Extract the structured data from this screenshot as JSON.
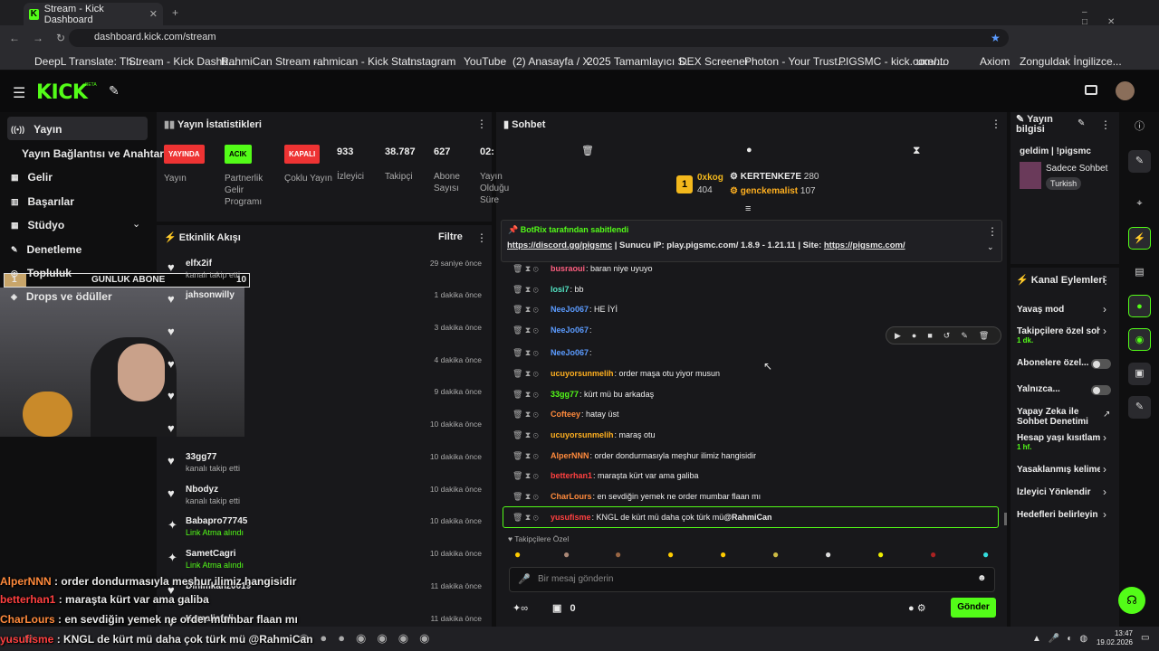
{
  "browser": {
    "tab_title": "Stream - Kick Dashboard",
    "url": "dashboard.kick.com/stream",
    "bookmarks": [
      "DeepL Translate: Th...",
      "Stream - Kick Dashb...",
      "RahmiCan Stream -...",
      "rahmican - Kick Stat...",
      "Instagram",
      "YouTube",
      "(2) Anasayfa / X",
      "2025 Tamamlayıcı S...",
      "DEX Screener",
      "Photon - Your Trust...",
      "PIGSMC - kick.com/...",
      "uxento",
      "Axiom",
      "Zonguldak İngilizce..."
    ]
  },
  "kick": {
    "logo": "KICK",
    "beta": "BETA"
  },
  "sidebar": {
    "items": [
      "Yayın",
      "Yayın Bağlantısı ve Anahtarı",
      "Gelir",
      "Başarılar",
      "Stüdyo",
      "Denetleme",
      "Topluluk",
      "Drops ve ödüller"
    ]
  },
  "overlay": {
    "goal_label": "GUNLUK ABONE",
    "goal_start": "1",
    "goal_target": "10"
  },
  "stats": {
    "title": "Yayın İstatistikleri",
    "items": [
      {
        "badge": "YAYINDA",
        "label": "Yayın"
      },
      {
        "badge": "ACIK",
        "label": "Partnerlik Gelir Programı"
      },
      {
        "badge": "KAPALI",
        "label": "Çoklu Yayın"
      },
      {
        "value": "933",
        "label": "İzleyici"
      },
      {
        "value": "38.787",
        "label": "Takipçi"
      },
      {
        "value": "627",
        "label": "Abone Sayısı"
      },
      {
        "value": "02:",
        "label": "Yayın Olduğu Süre"
      }
    ]
  },
  "activity": {
    "title": "Etkinlik Akışı",
    "filter": "Filtre",
    "items": [
      {
        "name": "elfx2if",
        "sub": "kanalı takip etti",
        "time": "29 saniye önce"
      },
      {
        "name": "jahsonwilly",
        "sub": "",
        "time": "1 dakika önce"
      },
      {
        "name": "",
        "sub": "",
        "time": "3 dakika önce"
      },
      {
        "name": "",
        "sub": "",
        "time": "4 dakika önce"
      },
      {
        "name": "",
        "sub": "",
        "time": "9 dakika önce"
      },
      {
        "name": "",
        "sub": "",
        "time": "10 dakika önce"
      },
      {
        "name": "33gg77",
        "sub": "kanalı takip etti",
        "time": "10 dakika önce"
      },
      {
        "name": "Nbodyz",
        "sub": "kanalı takip etti",
        "time": "10 dakika önce"
      },
      {
        "name": "Babapro77745",
        "sub": "Link Atma alındı",
        "time": "10 dakika önce"
      },
      {
        "name": "SametCagri",
        "sub": "Link Atma alındı",
        "time": "10 dakika önce"
      },
      {
        "name": "Dinimkanz0019",
        "sub": "",
        "time": "11 dakika önce"
      },
      {
        "name": "Kemaliafeli",
        "sub": "",
        "time": "11 dakika önce"
      }
    ]
  },
  "chat": {
    "title": "Sohbet",
    "leaders": [
      {
        "name": "0xkog",
        "count": "404"
      },
      {
        "name": "KERTENKE7E",
        "count": "280"
      },
      {
        "name": "genckemalist",
        "count": "107"
      }
    ],
    "pinned_by": "BotRix tarafından sabitlendi",
    "pinned_link1": "https://discord.gg/pigsmc",
    "pinned_mid": " | Sunucu IP: play.pigsmc.com/ 1.8.9 - 1.21.11 | Site: ",
    "pinned_link2": "https://pigsmc.com/",
    "messages": [
      {
        "user": "busraoui",
        "text": ": baran niye uyuyo",
        "color": "#ff5f80"
      },
      {
        "user": "losi7",
        "text": ": bb",
        "color": "#53e4c4"
      },
      {
        "user": "NeeJo067",
        "text": ": HE İYİ",
        "color": "#5b9bff"
      },
      {
        "user": "NeeJo067",
        "text": ":",
        "color": "#5b9bff"
      },
      {
        "user": "NeeJo067",
        "text": ":",
        "color": "#5b9bff"
      },
      {
        "user": "ucuyorsunmelih",
        "text": ": order maşa otu yiyor musun",
        "color": "#ffb020"
      },
      {
        "user": "33gg77",
        "text": ": kürt mü bu arkadaş",
        "color": "#53fc18"
      },
      {
        "user": "Cofteey",
        "text": ": hatay üst",
        "color": "#ff8a3c"
      },
      {
        "user": "ucuyorsunmelih",
        "text": ": maraş otu",
        "color": "#ffb020"
      },
      {
        "user": "AlperNNN",
        "text": ": order dondurmasıyla meşhur ilimiz hangisidir",
        "color": "#ff8a3c"
      },
      {
        "user": "betterhan1",
        "text": ": maraşta kürt var ama galiba",
        "color": "#ff4040"
      },
      {
        "user": "CharLours",
        "text": ": en sevdiğin yemek ne order mumbar flaan mı",
        "color": "#ff8a3c"
      },
      {
        "user": "yusufisme",
        "text": ": KNGL de kürt mü daha çok türk mü ",
        "mention": "@RahmiCan",
        "color": "#ff4040"
      }
    ],
    "followers_only": "Takipçilere Özel",
    "input_placeholder": "Bir mesaj gönderin",
    "send": "Gönder",
    "points": "0"
  },
  "stream_info": {
    "title": "Yayın bilgisi",
    "stream_title": "geldim | !pigsmc",
    "mode": "Sadece Sohbet",
    "language": "Turkish"
  },
  "channel_actions": {
    "title": "Kanal Eylemleri",
    "items": [
      "Yavaş mod",
      "Takipçilere özel soh",
      "Abonelere özel...",
      "Yalnızca...",
      "Yapay Zeka ile Sohbet Denetimi",
      "Hesap yaşı kısıtlama",
      "Yasaklanmış kelime",
      "İzleyici Yönlendir",
      "Hedefleri belirleyin"
    ],
    "sub1": "1 dk.",
    "sub2": "1 hf."
  },
  "overlay_chat": [
    {
      "user": "AlperNNN",
      "text": " : order dondurmasıyla meşhur ilimiz hangisidir",
      "color": "#ff8a3c"
    },
    {
      "user": "betterhan1",
      "text": " : maraşta kürt var ama galiba",
      "color": "#ff4040"
    },
    {
      "user": "CharLours",
      "text": " : en sevdiğin yemek ne order mumbar flaan mı",
      "color": "#ff8a3c"
    },
    {
      "user": "yusufisme",
      "text": " : KNGL de kürt mü daha çok türk mü @RahmiCan",
      "color": "#ff4040"
    }
  ],
  "clock": {
    "time": "13:47",
    "date": "19.02.2026"
  }
}
